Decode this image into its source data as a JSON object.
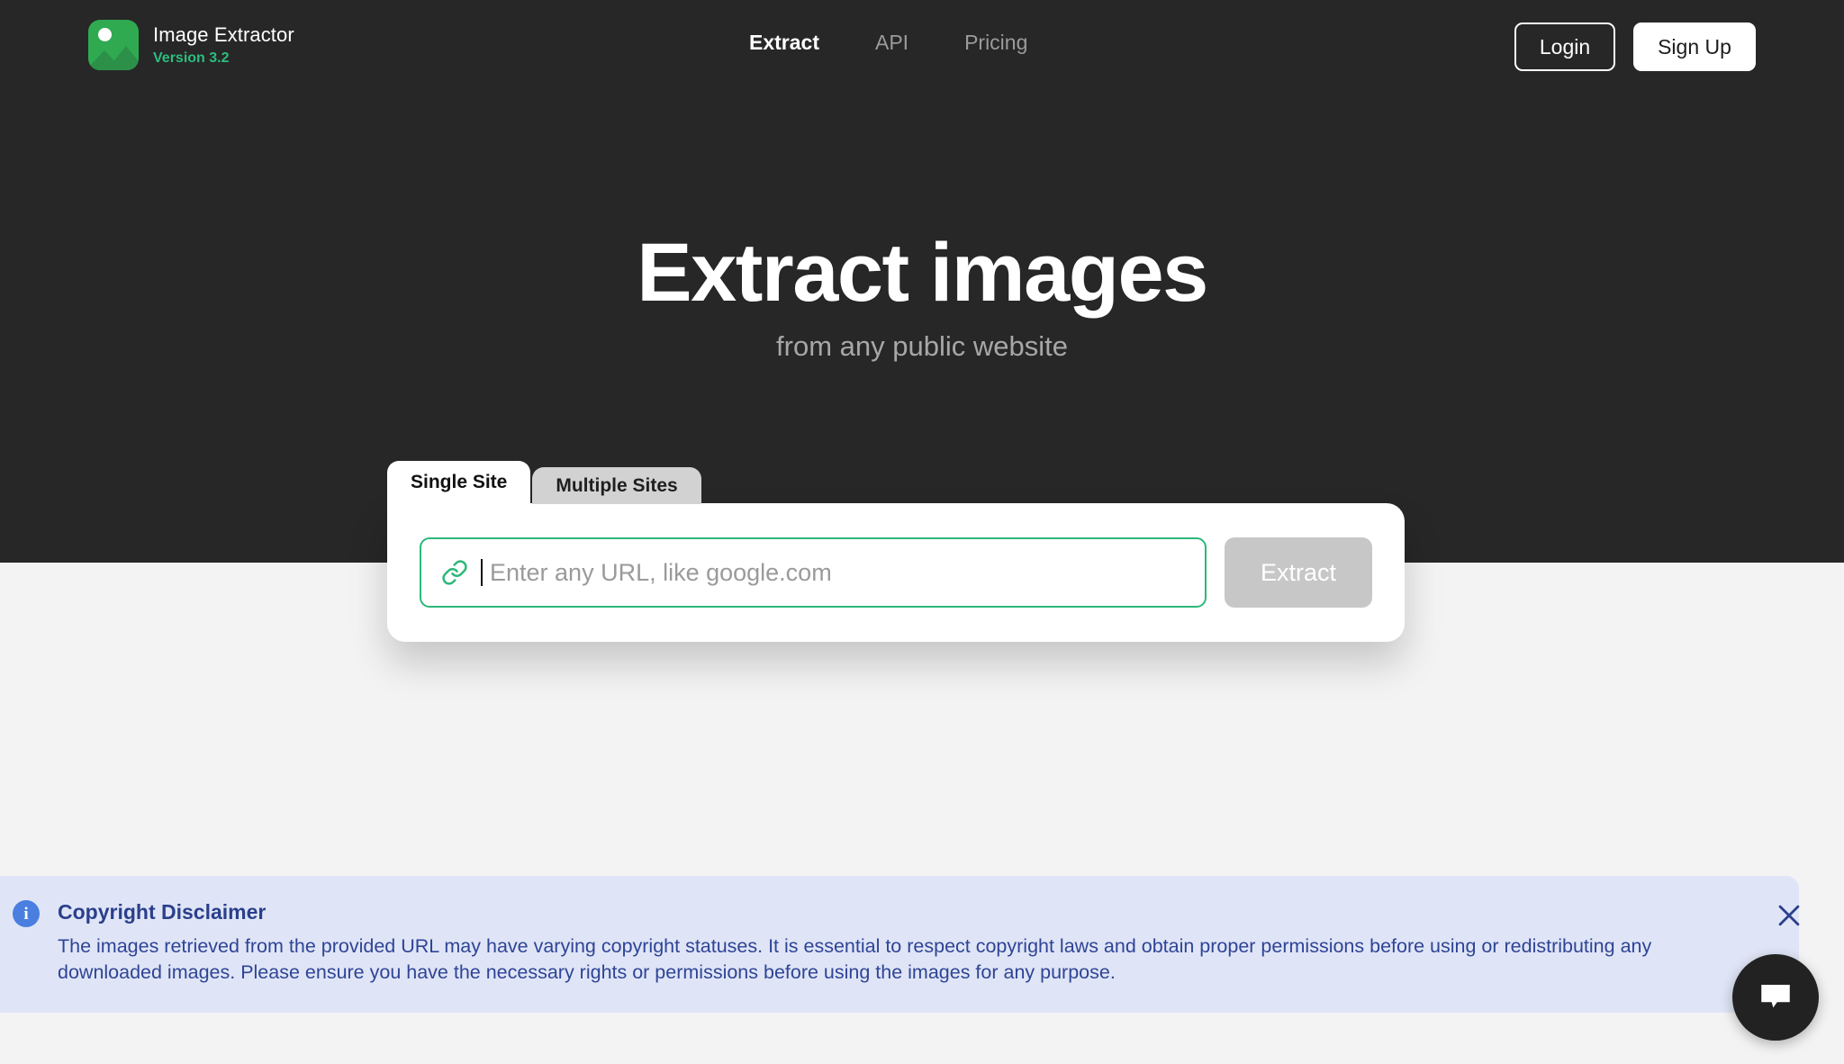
{
  "header": {
    "brand": {
      "title": "Image Extractor",
      "version": "Version 3.2",
      "logo_icon": "image-mountain-icon",
      "accent_color": "#2faa51"
    },
    "nav": [
      {
        "label": "Extract",
        "active": true
      },
      {
        "label": "API",
        "active": false
      },
      {
        "label": "Pricing",
        "active": false
      }
    ],
    "auth": {
      "login_label": "Login",
      "signup_label": "Sign Up"
    }
  },
  "hero": {
    "title": "Extract images",
    "subtitle": "from any public website",
    "background_color": "#272727"
  },
  "extractor": {
    "tabs": [
      {
        "label": "Single Site",
        "active": true
      },
      {
        "label": "Multiple Sites",
        "active": false
      }
    ],
    "url_input": {
      "value": "",
      "placeholder": "Enter any URL, like google.com",
      "icon": "link-icon",
      "border_color": "#2cb87a",
      "focused": true
    },
    "extract_button": {
      "label": "Extract",
      "disabled": true,
      "color": "#c7c7c7"
    }
  },
  "disclaimer": {
    "icon": "info-icon",
    "icon_glyph": "i",
    "title": "Copyright Disclaimer",
    "text": "The images retrieved from the provided URL may have varying copyright statuses. It is essential to respect copyright laws and obtain proper permissions before using or redistributing any downloaded images. Please ensure you have the necessary rights or permissions before using the images for any purpose.",
    "close_icon": "close-icon",
    "background_color": "#dfe5f6",
    "text_color": "#2f4496"
  },
  "chat": {
    "icon": "chat-bubble-icon",
    "background_color": "#222222"
  }
}
